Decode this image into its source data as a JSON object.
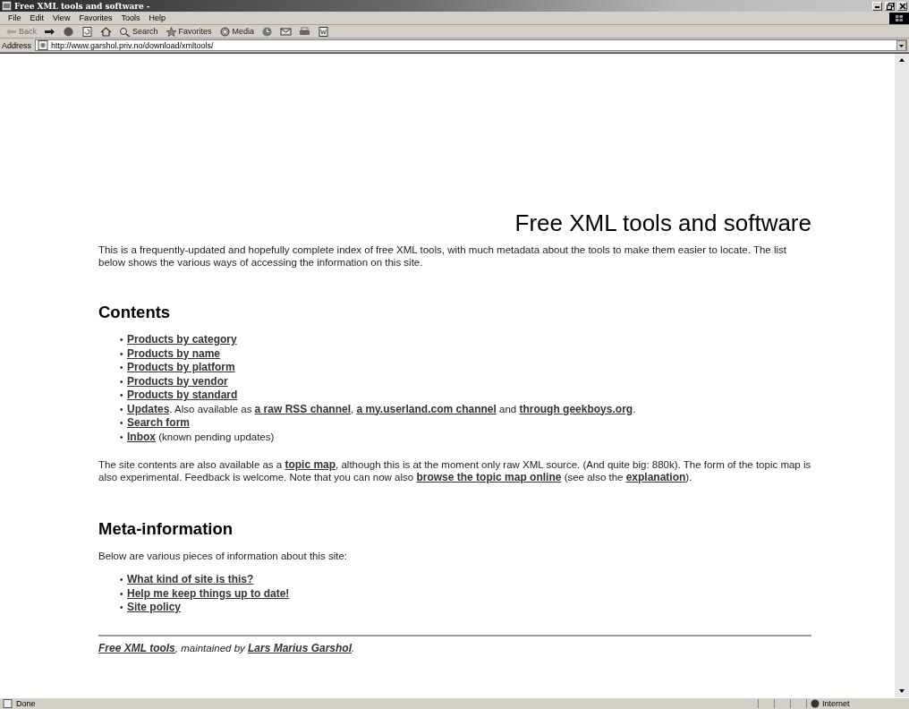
{
  "window": {
    "title": "Free XML tools and software -"
  },
  "menu": [
    "File",
    "Edit",
    "View",
    "Favorites",
    "Tools",
    "Help"
  ],
  "toolbar": [
    {
      "kind": "back",
      "label": "Back",
      "disabled": true
    },
    {
      "kind": "forward",
      "disabled": false
    },
    {
      "kind": "stop",
      "disabled": false
    },
    {
      "kind": "refresh",
      "disabled": false
    },
    {
      "kind": "home",
      "disabled": false
    },
    {
      "kind": "search",
      "label": "Search",
      "disabled": false
    },
    {
      "kind": "favorites",
      "label": "Favorites",
      "disabled": false
    },
    {
      "kind": "media",
      "label": "Media",
      "disabled": false
    },
    {
      "kind": "history",
      "disabled": false
    },
    {
      "kind": "mail",
      "disabled": false
    },
    {
      "kind": "print",
      "disabled": false
    },
    {
      "kind": "edit",
      "disabled": false
    }
  ],
  "address": {
    "label": "Address",
    "value": "http://www.garshol.priv.no/download/xmltools/"
  },
  "page": {
    "title": "Free XML tools and software",
    "intro": "This is a frequently-updated and hopefully complete index of free XML tools, with much metadata about the tools to make them easier to locate. The list below shows the various ways of accessing the information on this site.",
    "contents_heading": "Contents",
    "contents": [
      {
        "bullet": "•",
        "parts": [
          {
            "text": "Products by category",
            "kind": "link"
          }
        ]
      },
      {
        "bullet": "•",
        "parts": [
          {
            "text": "Products by name",
            "kind": "link"
          }
        ]
      },
      {
        "bullet": "•",
        "parts": [
          {
            "text": "Products by platform",
            "kind": "link"
          }
        ]
      },
      {
        "bullet": "•",
        "parts": [
          {
            "text": "Products by vendor",
            "kind": "link"
          }
        ]
      },
      {
        "bullet": "•",
        "parts": [
          {
            "text": "Products by standard",
            "kind": "link"
          }
        ]
      },
      {
        "bullet": "•",
        "parts": [
          {
            "text": "Updates",
            "kind": "link"
          },
          {
            "text": ". Also available as ",
            "kind": "text"
          },
          {
            "text": "a raw RSS channel",
            "kind": "link"
          },
          {
            "text": ", ",
            "kind": "text"
          },
          {
            "text": "a my.userland.com channel",
            "kind": "link"
          },
          {
            "text": " and ",
            "kind": "text"
          },
          {
            "text": "through geekboys.org",
            "kind": "link"
          },
          {
            "text": ".",
            "kind": "text"
          }
        ]
      },
      {
        "bullet": "•",
        "parts": [
          {
            "text": "Search form",
            "kind": "link"
          }
        ]
      },
      {
        "bullet": "•",
        "parts": [
          {
            "text": "Inbox",
            "kind": "link"
          },
          {
            "text": " (known pending updates)",
            "kind": "text"
          }
        ]
      }
    ],
    "topic_paragraph": [
      {
        "text": "The site contents are also available as a ",
        "kind": "text"
      },
      {
        "text": "topic map",
        "kind": "link"
      },
      {
        "text": ", although this is at the moment only raw XML source. (And quite big: 880k). The form of the topic map is also experimental. Feedback is welcome. Note that you can now also ",
        "kind": "text"
      },
      {
        "text": "browse the topic map online",
        "kind": "link"
      },
      {
        "text": " (see also the ",
        "kind": "text"
      },
      {
        "text": "explanation",
        "kind": "link"
      },
      {
        "text": ").",
        "kind": "text"
      }
    ],
    "meta_heading": "Meta-information",
    "meta_intro": "Below are various pieces of information about this site:",
    "meta": [
      {
        "bullet": "•",
        "parts": [
          {
            "text": "What kind of site is this?",
            "kind": "link"
          }
        ]
      },
      {
        "bullet": "•",
        "parts": [
          {
            "text": "Help me keep things up to date!",
            "kind": "link"
          }
        ]
      },
      {
        "bullet": "•",
        "parts": [
          {
            "text": "Site policy",
            "kind": "link"
          }
        ]
      }
    ],
    "footer": [
      {
        "text": "Free XML tools",
        "kind": "link"
      },
      {
        "text": ", maintained by ",
        "kind": "text"
      },
      {
        "text": "Lars Marius Garshol",
        "kind": "link"
      },
      {
        "text": ".",
        "kind": "text"
      }
    ]
  },
  "status_bar": {
    "text": "Done",
    "zone": "Internet"
  }
}
